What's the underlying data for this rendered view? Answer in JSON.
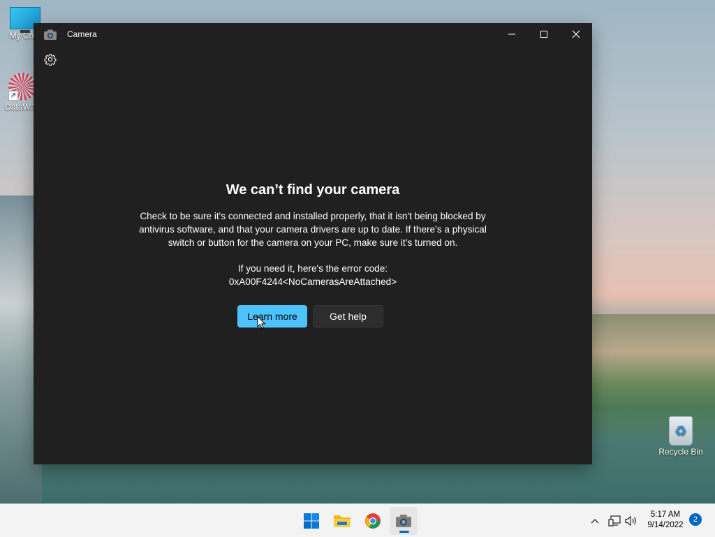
{
  "desktop": {
    "icons": [
      {
        "label": "My Com"
      },
      {
        "label": "DataWag"
      },
      {
        "label": "Recycle Bin"
      }
    ]
  },
  "window": {
    "title": "Camera",
    "controls": {
      "minimize": "—",
      "maximize": "☐",
      "close": "✕"
    }
  },
  "error": {
    "heading": "We can’t find your camera",
    "body": "Check to be sure it's connected and installed properly, that it isn't being blocked by antivirus software, and that your camera drivers are up to date. If there’s a physical switch or button for the camera on your PC, make sure it’s turned on.",
    "code_label": "If you need it, here's the error code:",
    "code": "0xA00F4244<NoCamerasAreAttached>"
  },
  "buttons": {
    "learn_more": "Learn more",
    "get_help": "Get help"
  },
  "taskbar": {
    "time": "5:17 AM",
    "date": "9/14/2022",
    "notification_count": "2"
  },
  "colors": {
    "accent": "#4cc2ff",
    "window_bg": "#202020",
    "taskbar_bg": "#f3f3f3",
    "badge": "#0067c0"
  }
}
